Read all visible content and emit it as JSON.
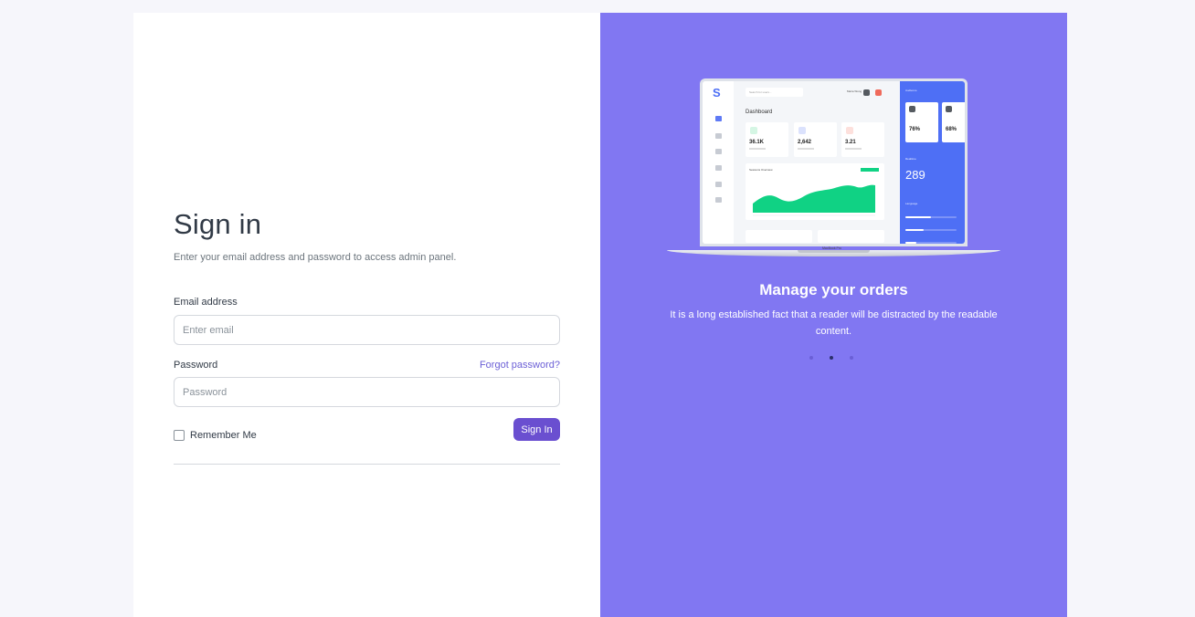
{
  "signin": {
    "title": "Sign in",
    "subtitle": "Enter your email address and password to access admin panel.",
    "email_label": "Email address",
    "email_placeholder": "Enter email",
    "email_value": "",
    "password_label": "Password",
    "forgot_label": "Forgot password?",
    "password_placeholder": "Password",
    "password_value": "",
    "remember_label": "Remember Me",
    "remember_checked": false,
    "submit_label": "Sign In"
  },
  "showcase": {
    "title": "Manage your orders",
    "text": "It is a long established fact that a reader will be distracted by the readable content.",
    "carousel": {
      "slides": 3,
      "active_index": 1
    },
    "mockup": {
      "search_placeholder": "Search for users...",
      "user_name": "Maria Wong",
      "page_title": "Dashboard",
      "cards": [
        {
          "value": "36.1K",
          "icon_color": "#28c76f"
        },
        {
          "value": "2,642",
          "icon_color": "#4e6ff5"
        },
        {
          "value": "3.21",
          "icon_color": "#ef6a5b"
        }
      ],
      "chart_title": "Sessions Overview",
      "side_title": "Audience",
      "side_cards": [
        {
          "value": "76%"
        },
        {
          "value": "68%"
        }
      ],
      "realtime_label": "Realtime",
      "realtime_value": "289",
      "language_label": "Language",
      "language_bars": [
        0.5,
        0.35,
        0.22
      ],
      "brand": "MacBook Pro"
    }
  },
  "colors": {
    "accent": "#6a4fd0",
    "panel": "#8177f2",
    "link": "#6b5fd6",
    "mock_blue": "#4e6ff5",
    "mock_green": "#10d284"
  }
}
